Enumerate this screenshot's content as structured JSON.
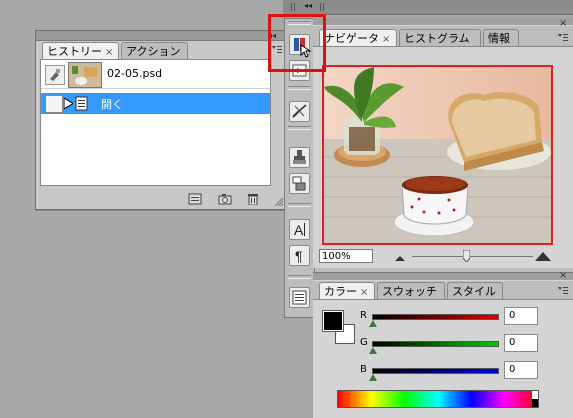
{
  "history_panel": {
    "tabs": [
      {
        "label": "ヒストリー",
        "active": true
      },
      {
        "label": "アクション",
        "active": false
      }
    ],
    "snapshot_name": "02-05.psd",
    "step_label": "開く"
  },
  "navigator_panel": {
    "tabs": [
      {
        "label": "ナビゲータ",
        "active": true
      },
      {
        "label": "ヒストグラム",
        "active": false
      },
      {
        "label": "情報",
        "active": false
      }
    ],
    "zoom": "100%"
  },
  "color_panel": {
    "tabs": [
      {
        "label": "カラー",
        "active": true
      },
      {
        "label": "スウォッチ",
        "active": false
      },
      {
        "label": "スタイル",
        "active": false
      }
    ],
    "sliders": [
      {
        "name": "R",
        "value": "0",
        "color": "#e00000"
      },
      {
        "name": "G",
        "value": "0",
        "color": "#00c000"
      },
      {
        "name": "B",
        "value": "0",
        "color": "#0000d0"
      }
    ]
  },
  "colors": {
    "selection": "#3399ff",
    "highlight": "#e01010",
    "foreground": "#000000",
    "background": "#ffffff"
  }
}
